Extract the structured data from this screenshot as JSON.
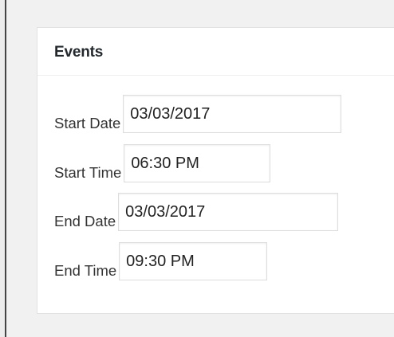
{
  "panel": {
    "title": "Events"
  },
  "fields": {
    "start_date": {
      "label": "Start Date",
      "value": "03/03/2017"
    },
    "start_time": {
      "label": "Start Time",
      "value": "06:30 PM"
    },
    "end_date": {
      "label": "End Date",
      "value": "03/03/2017"
    },
    "end_time": {
      "label": "End Time",
      "value": "09:30 PM"
    }
  }
}
